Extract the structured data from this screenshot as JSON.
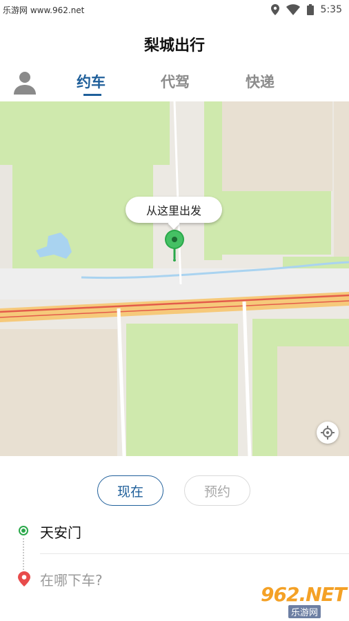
{
  "status_bar": {
    "left_text": "乐游网 www.962.net",
    "time": "5:35",
    "icons": [
      "location-icon",
      "wifi-icon",
      "battery-icon"
    ]
  },
  "header": {
    "title": "梨城出行"
  },
  "tabs": [
    {
      "label": "约车",
      "active": true
    },
    {
      "label": "代驾",
      "active": false
    },
    {
      "label": "快递",
      "active": false
    }
  ],
  "map": {
    "start_bubble": "从这里出发",
    "colors": {
      "green_area": "#cfe9ad",
      "road_main": "#f6c97a",
      "road_edge": "#e35b4a",
      "water": "#a9d3f0",
      "pin": "#2aa84a"
    }
  },
  "time_options": {
    "now": "现在",
    "reserve": "预约"
  },
  "route": {
    "origin": "天安门",
    "destination_placeholder": "在哪下车?"
  },
  "watermark": {
    "logo": "962.NET",
    "sub": "乐游网"
  },
  "accent_color": "#1f5f9a"
}
